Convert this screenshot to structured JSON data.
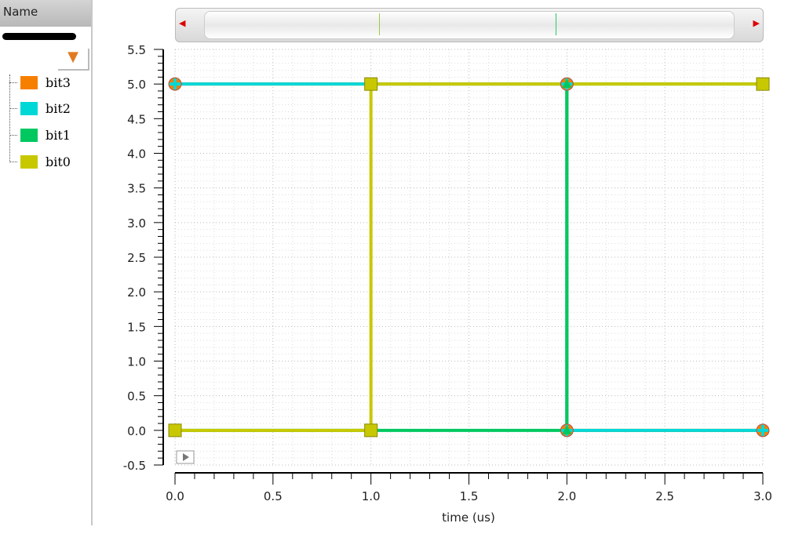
{
  "panel": {
    "header": "Name",
    "filter_icon": "funnel-icon"
  },
  "legend": [
    {
      "label": "bit3",
      "color": "#f77f00"
    },
    {
      "label": "bit2",
      "color": "#00d8d8"
    },
    {
      "label": "bit1",
      "color": "#00c860"
    },
    {
      "label": "bit0",
      "color": "#c8c800"
    }
  ],
  "chart_data": {
    "type": "line",
    "xlabel": "time (us)",
    "ylabel": "",
    "xlim": [
      0,
      3
    ],
    "ylim": [
      -0.5,
      5.5
    ],
    "xticks": [
      "0.0",
      "0.5",
      "1.0",
      "1.5",
      "2.0",
      "2.5",
      "3.0"
    ],
    "yticks": [
      "5.5",
      "5.0",
      "4.5",
      "4.0",
      "3.5",
      "3.0",
      "2.5",
      "2.0",
      "1.5",
      "1.0",
      "0.5",
      "0.0",
      "-0.5"
    ],
    "grid": true,
    "series": [
      {
        "name": "bit3",
        "color": "#f77f00",
        "marker": "circle",
        "points": [
          [
            0,
            5
          ],
          [
            2,
            5
          ],
          [
            2,
            0
          ],
          [
            3,
            0
          ]
        ]
      },
      {
        "name": "bit2",
        "color": "#00d8d8",
        "marker": "cross",
        "points": [
          [
            0,
            5
          ],
          [
            2,
            5
          ],
          [
            2,
            0
          ],
          [
            3,
            0
          ]
        ]
      },
      {
        "name": "bit1",
        "color": "#00c860",
        "marker": "triangle",
        "points": [
          [
            0,
            0
          ],
          [
            2,
            0
          ],
          [
            2,
            5
          ],
          [
            3,
            5
          ]
        ]
      },
      {
        "name": "bit0",
        "color": "#c8c800",
        "marker": "square",
        "points": [
          [
            0,
            0
          ],
          [
            1,
            0
          ],
          [
            1,
            5
          ],
          [
            3,
            5
          ]
        ]
      }
    ]
  }
}
